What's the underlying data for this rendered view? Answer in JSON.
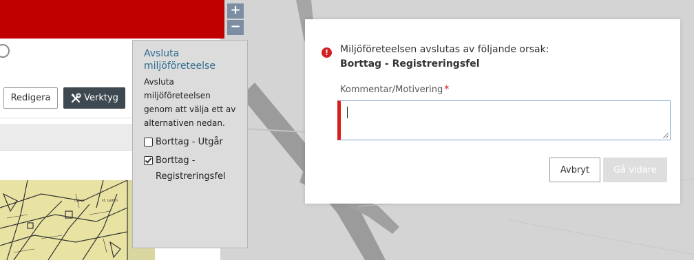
{
  "left_panel": {
    "toolbar": {
      "edit_label": "Redigera",
      "tools_label": "Verktyg",
      "tools_icon": "wrench-screwdriver-icon"
    },
    "map_labels": [
      "ing sir",
      "st. Leiten"
    ]
  },
  "zoom": {
    "in_label": "+",
    "out_label": "−"
  },
  "popover": {
    "title": "Avsluta miljöföreteelse",
    "description": "Avsluta miljöföreteelsen genom att välja ett av alternativen nedan.",
    "options": [
      {
        "label": "Borttag - Utgår",
        "checked": false
      },
      {
        "label": "Borttag - Registreringsfel",
        "checked": true
      }
    ]
  },
  "dialog": {
    "message": "Miljöföreteelsen avslutas av följande orsak:",
    "reason": "Borttag - Registreringsfel",
    "comment_label": "Kommentar/Motivering",
    "required_mark": "*",
    "comment_value": "",
    "cancel_label": "Avbryt",
    "continue_label": "Gå vidare",
    "warning_color": "#d42020"
  }
}
